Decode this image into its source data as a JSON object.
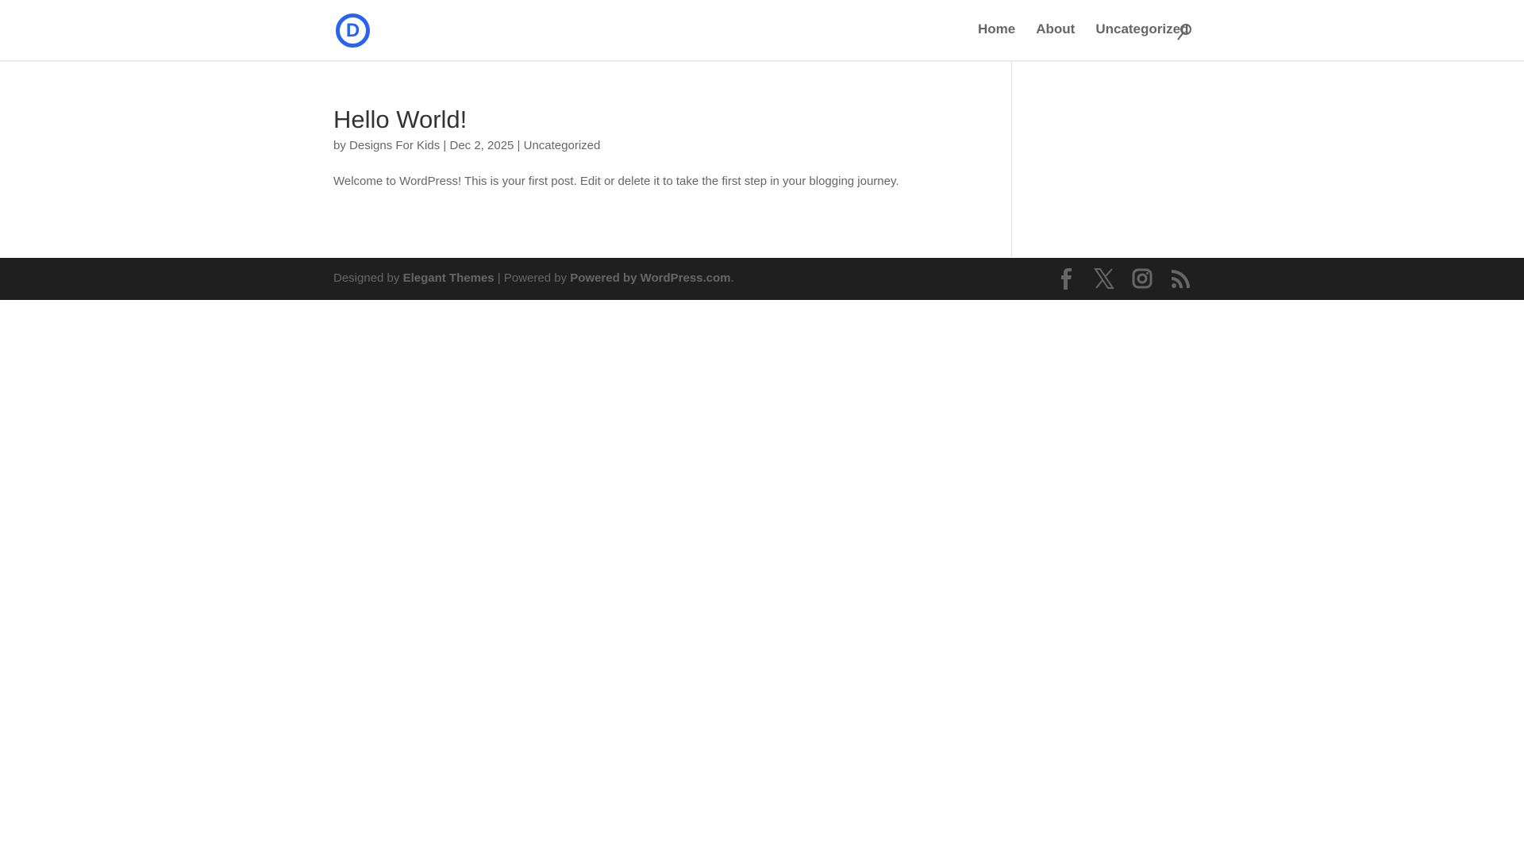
{
  "header": {
    "logo_letter": "D",
    "nav": [
      "Home",
      "About",
      "Uncategorized"
    ]
  },
  "post": {
    "title": "Hello World!",
    "by": "by",
    "author": "Designs For Kids",
    "date": "Dec 2, 2025",
    "category": "Uncategorized",
    "separator": "|",
    "excerpt": "Welcome to WordPress! This is your first post. Edit or delete it to take the first step in your blogging journey."
  },
  "footer": {
    "designed_by": "Designed by",
    "elegant": "Elegant Themes",
    "powered_sep": "| Powered by",
    "wordpress": "Powered by WordPress.com",
    "end": ".",
    "social": [
      "facebook-icon",
      "x-icon",
      "instagram-icon",
      "rss-icon"
    ]
  },
  "colors": {
    "accent": "#2863f2",
    "footer_bg": "#1f1f1f"
  }
}
